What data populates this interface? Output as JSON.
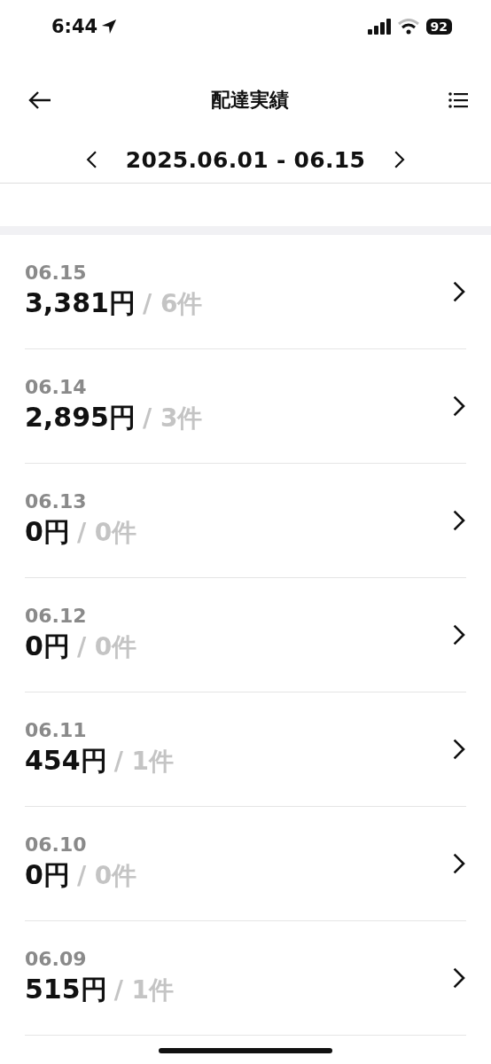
{
  "status_bar": {
    "time": "6:44",
    "battery": "92"
  },
  "header": {
    "title": "配達実績"
  },
  "period": {
    "label": "2025.06.01 - 06.15"
  },
  "days": [
    {
      "date": "06.15",
      "amount": "3,381円",
      "count": "/ 6件"
    },
    {
      "date": "06.14",
      "amount": "2,895円",
      "count": "/ 3件"
    },
    {
      "date": "06.13",
      "amount": "0円",
      "count": "/ 0件"
    },
    {
      "date": "06.12",
      "amount": "0円",
      "count": "/ 0件"
    },
    {
      "date": "06.11",
      "amount": "454円",
      "count": "/ 1件"
    },
    {
      "date": "06.10",
      "amount": "0円",
      "count": "/ 0件"
    },
    {
      "date": "06.09",
      "amount": "515円",
      "count": "/ 1件"
    }
  ]
}
